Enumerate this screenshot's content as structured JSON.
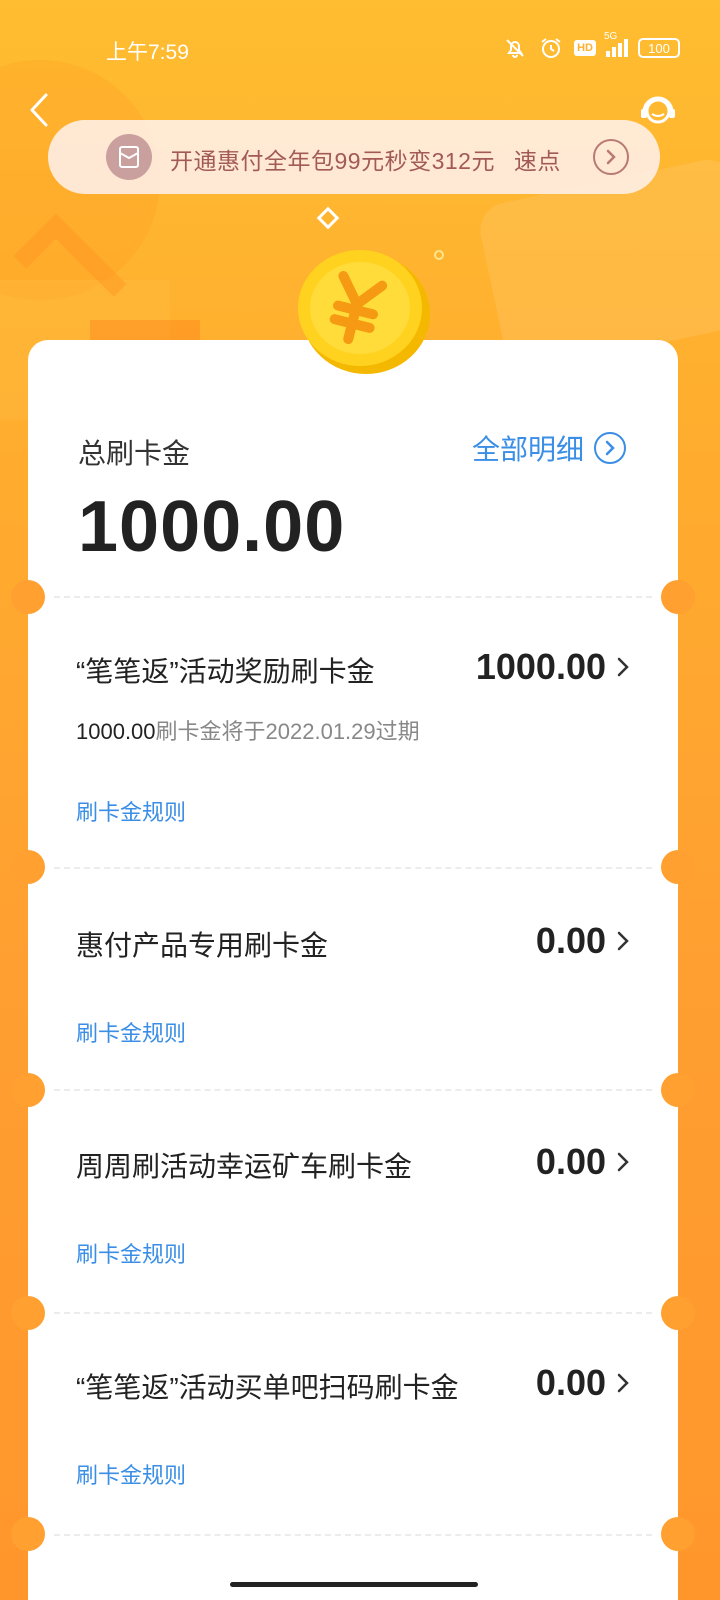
{
  "status_bar": {
    "time": "上午7:59",
    "signal_label": "5G",
    "hd_label": "HD",
    "battery": "100"
  },
  "banner": {
    "text": "开通惠付全年包99元秒变312元",
    "cta": "速点"
  },
  "summary": {
    "label": "总刷卡金",
    "detail_link": "全部明细",
    "total": "1000.00"
  },
  "items": [
    {
      "title": "“笔笔返”活动奖励刷卡金",
      "amount": "1000.00",
      "expire_amount": "1000.00",
      "expire_text": "刷卡金将于2022.01.29过期",
      "rule": "刷卡金规则"
    },
    {
      "title": "惠付产品专用刷卡金",
      "amount": "0.00",
      "rule": "刷卡金规则"
    },
    {
      "title": "周周刷活动幸运矿车刷卡金",
      "amount": "0.00",
      "rule": "刷卡金规则"
    },
    {
      "title": "“笔笔返”活动买单吧扫码刷卡金",
      "amount": "0.00",
      "rule": "刷卡金规则"
    }
  ],
  "colors": {
    "accent_blue": "#3a8ee6",
    "background_orange": "#ffa031",
    "banner_text": "#a25a55"
  }
}
